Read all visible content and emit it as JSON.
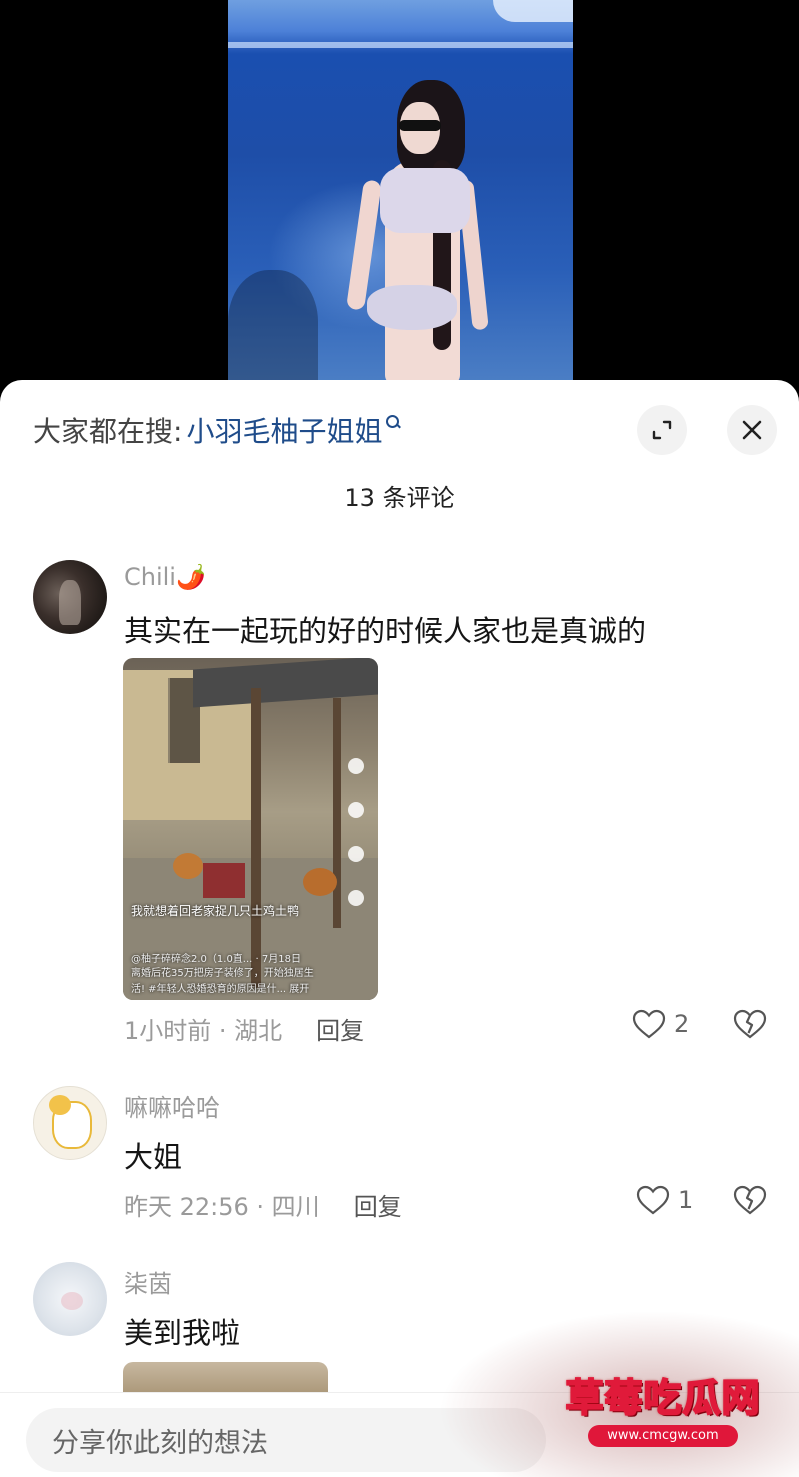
{
  "search": {
    "label": "大家都在搜:",
    "term": "小羽毛柚子姐姐"
  },
  "header": {
    "comment_count": "13 条评论",
    "expand_icon": "expand-icon",
    "close_icon": "close-icon"
  },
  "comments": [
    {
      "name": "Chili🌶️",
      "text": "其实在一起玩的好的时候人家也是真诚的",
      "meta": "1小时前 · 湖北",
      "reply": "回复",
      "likes": "2",
      "attachment": {
        "caption": "我就想着回老家捉几只土鸡土鸭",
        "author": "@柚子碎碎念2.0（1.0直... · 7月18日",
        "desc1": "离婚后花35万把房子装修了，开始独居生",
        "desc2": "活! #年轻人恐婚恐育的原因是什... 展开"
      }
    },
    {
      "name": "嘛嘛哈哈",
      "text": "大姐",
      "meta": "昨天 22:56 · 四川",
      "reply": "回复",
      "likes": "1"
    },
    {
      "name": "柒茵",
      "text": "美到我啦"
    }
  ],
  "input": {
    "placeholder": "分享你此刻的想法"
  },
  "watermark": {
    "title": "草莓吃瓜网",
    "url": "www.cmcgw.com"
  }
}
